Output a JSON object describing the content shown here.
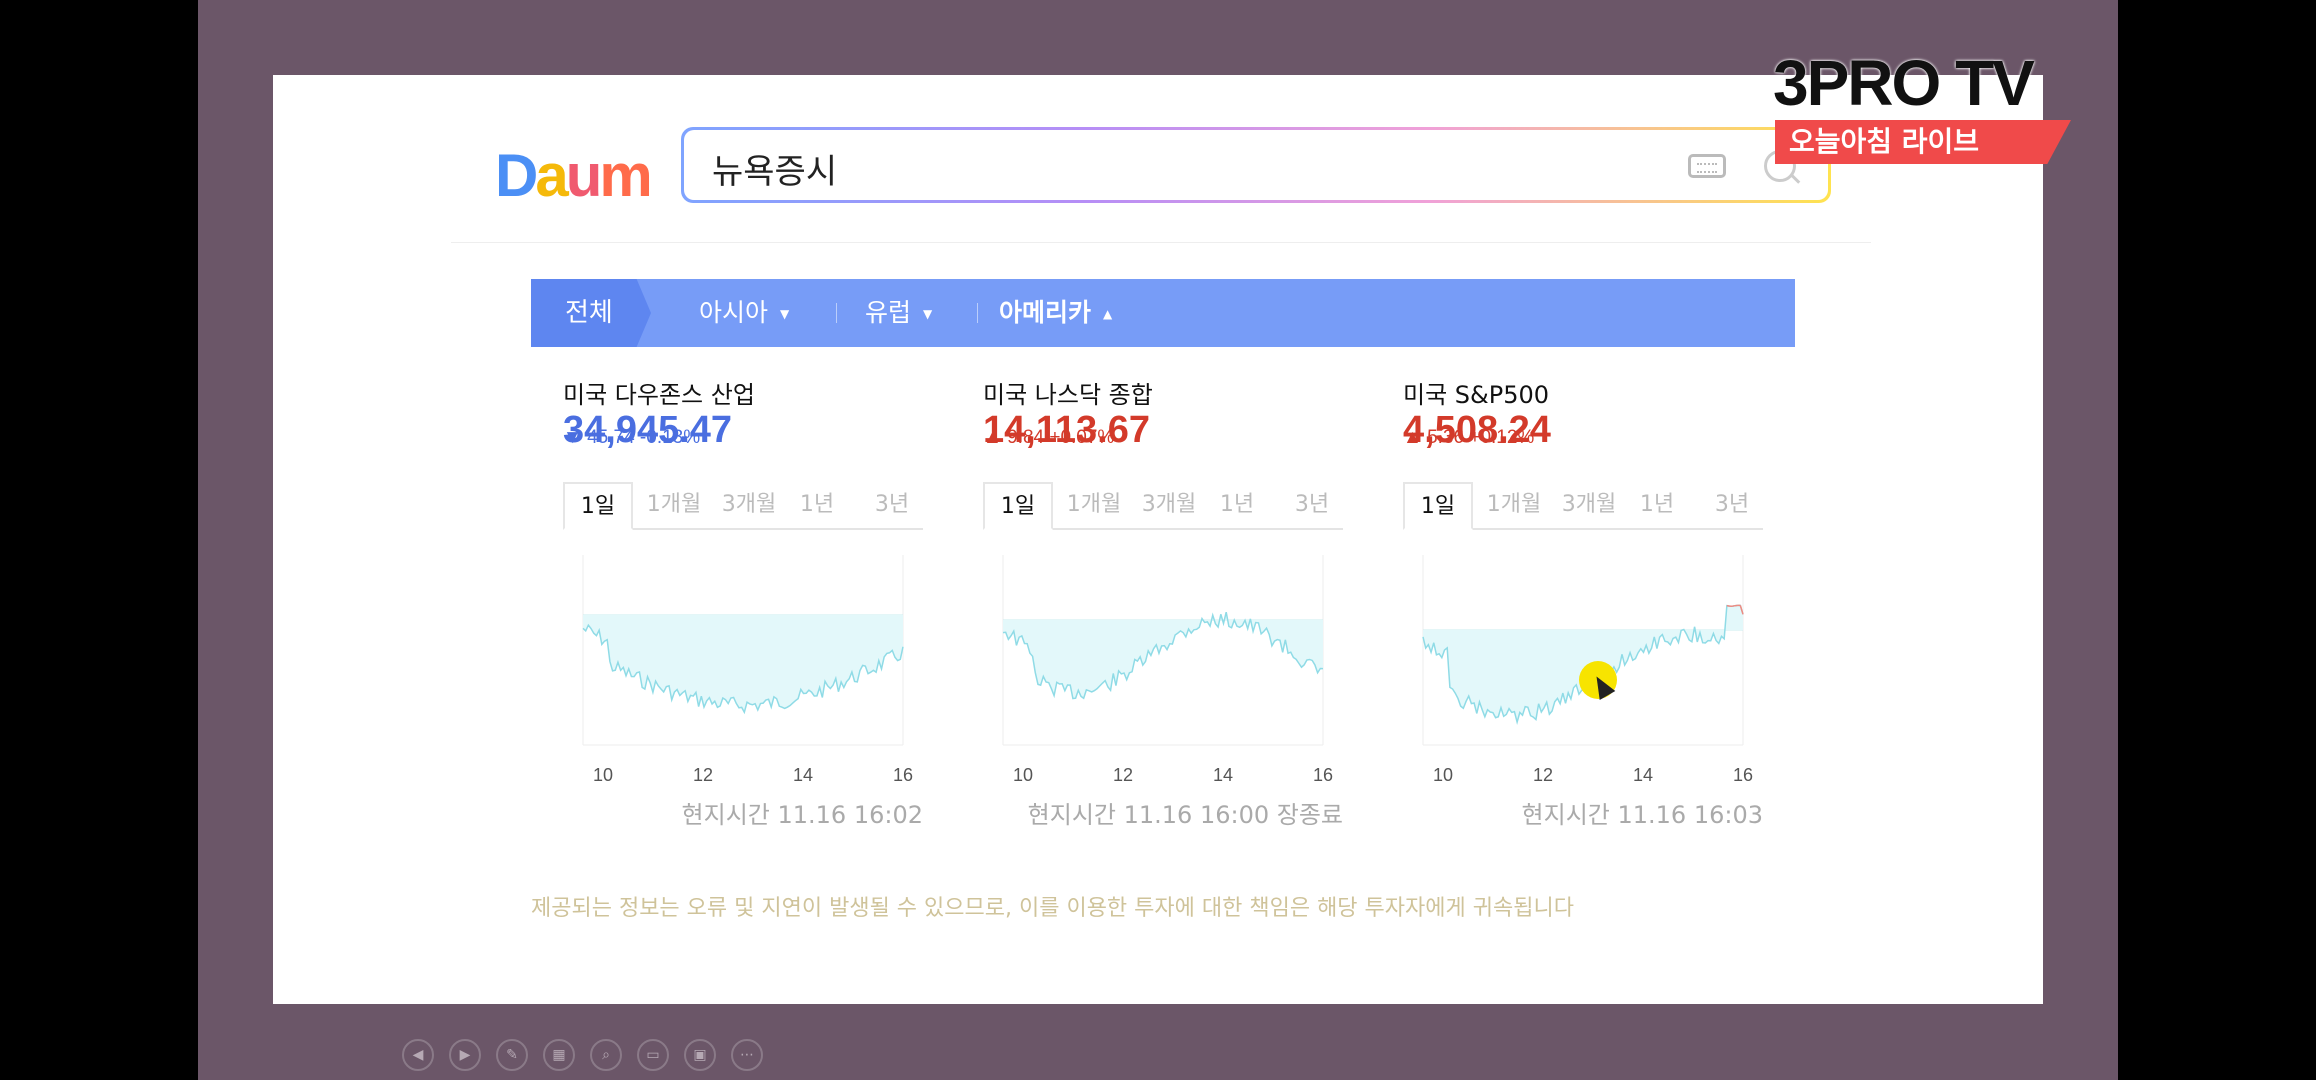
{
  "search": {
    "query": "뉴욕증시"
  },
  "logo": {
    "text": "Daum"
  },
  "brand": {
    "title": "3PRO TV",
    "subtitle": "오늘아침 라이브"
  },
  "tabs": [
    {
      "label": "전체"
    },
    {
      "label": "아시아"
    },
    {
      "label": "유럽"
    },
    {
      "label": "아메리카"
    }
  ],
  "periods": [
    "1일",
    "1개월",
    "3개월",
    "1년",
    "3년"
  ],
  "indices": [
    {
      "name": "미국 다우존스 산업",
      "price": "34,945.47",
      "arrow": "▼",
      "change": "45.74 -0.13%",
      "direction": "down",
      "ticks": [
        "10",
        "12",
        "14",
        "16"
      ],
      "timestamp": "현지시간 11.16 16:02"
    },
    {
      "name": "미국 나스닥 종합",
      "price": "14,113.67",
      "arrow": "▲",
      "change": "9.84 +0.07%",
      "direction": "up",
      "ticks": [
        "10",
        "12",
        "14",
        "16"
      ],
      "timestamp": "현지시간 11.16 16:00 장종료"
    },
    {
      "name": "미국 S&P500",
      "price": "4,508.24",
      "arrow": "▲",
      "change": "5.36 +0.12%",
      "direction": "up",
      "ticks": [
        "10",
        "12",
        "14",
        "16"
      ],
      "timestamp": "현지시간 11.16 16:03"
    }
  ],
  "disclaimer": "제공되는 정보는 오류 및 지연이 발생될 수 있으므로, 이를 이용한 투자에 대한 책임은 해당 투자자에게 귀속됩니다",
  "colors": {
    "down": "#4a6ee0",
    "up": "#d33a2a",
    "tab_bar": "#779cf7",
    "frame": "#6b5668"
  },
  "toolbar_icons": [
    "prev-icon",
    "next-icon",
    "pen-icon",
    "slides-icon",
    "zoom-icon",
    "subtitle-icon",
    "camera-icon",
    "more-icon"
  ]
}
